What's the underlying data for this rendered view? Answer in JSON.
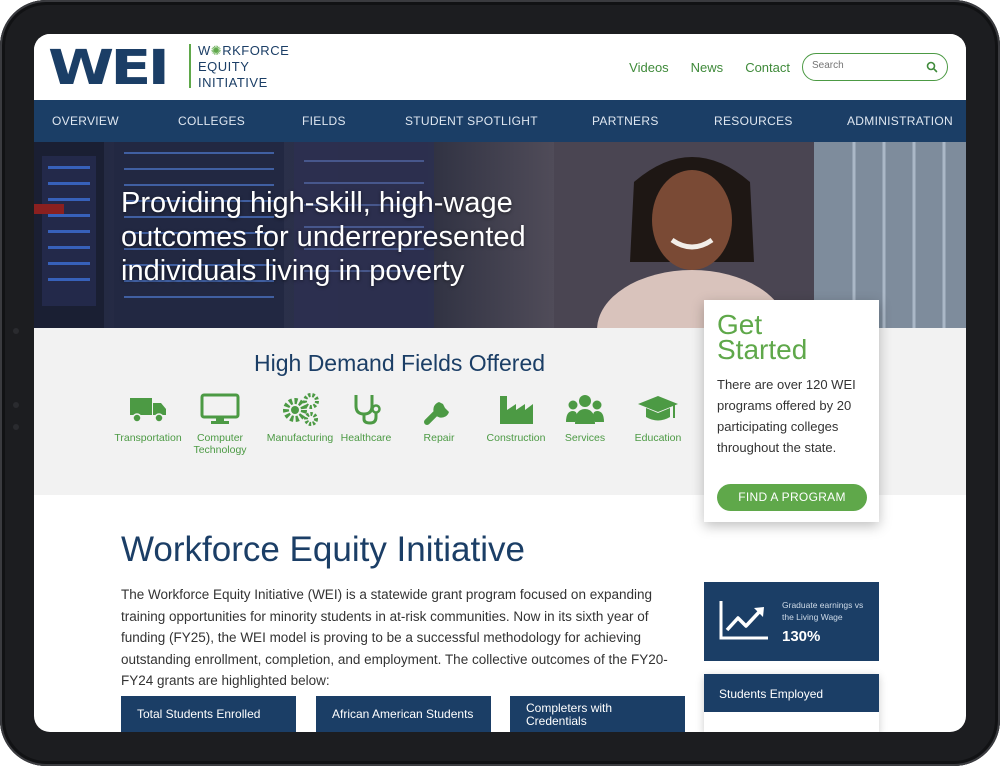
{
  "header": {
    "logo_mark": "WEI",
    "logo_line1_pre": "W",
    "logo_line1_post": "RKFORCE",
    "logo_line2": "EQUITY",
    "logo_line3": "INITIATIVE",
    "links": [
      "Videos",
      "News",
      "Contact"
    ],
    "search_placeholder": "Search"
  },
  "nav": [
    "OVERVIEW",
    "COLLEGES",
    "FIELDS",
    "STUDENT SPOTLIGHT",
    "PARTNERS",
    "RESOURCES",
    "ADMINISTRATION"
  ],
  "hero": {
    "title": "Providing high-skill, high-wage outcomes for underrepresented individuals living in poverty"
  },
  "fields": {
    "title": "High Demand Fields Offered",
    "items": [
      {
        "label": "Transportation",
        "icon": "truck-icon"
      },
      {
        "label": "Computer Technology",
        "icon": "monitor-icon"
      },
      {
        "label": "Manufacturing",
        "icon": "gears-icon"
      },
      {
        "label": "Healthcare",
        "icon": "stethoscope-icon"
      },
      {
        "label": "Repair",
        "icon": "wrench-icon"
      },
      {
        "label": "Construction",
        "icon": "factory-icon"
      },
      {
        "label": "Services",
        "icon": "users-icon"
      },
      {
        "label": "Education",
        "icon": "graduation-cap-icon"
      }
    ]
  },
  "get_started": {
    "title": "Get Started",
    "body": "There are over 120 WEI programs offered by 20 participating colleges throughout the state.",
    "button": "FIND A PROGRAM"
  },
  "main": {
    "title": "Workforce Equity Initiative",
    "body": "The Workforce Equity Initiative (WEI) is a statewide grant program focused on expanding training opportunities for minority students in at-risk communities. Now in its sixth year of funding (FY25), the WEI model is proving to be a successful methodology for achieving outstanding enrollment, completion, and employment. The collective outcomes of the FY20-FY24 grants are highlighted below:",
    "stats": [
      "Total Students Enrolled",
      "African American Students",
      "Completers with Credentials"
    ]
  },
  "earnings": {
    "label": "Graduate earnings vs the Living Wage",
    "value": "130%",
    "icon": "trend-chart-icon"
  },
  "employed": {
    "title": "Students Employed"
  },
  "colors": {
    "navy": "#1b3e66",
    "green": "#5fa84a",
    "link_green": "#3f8a3a",
    "light_gray": "#f2f2f2"
  }
}
